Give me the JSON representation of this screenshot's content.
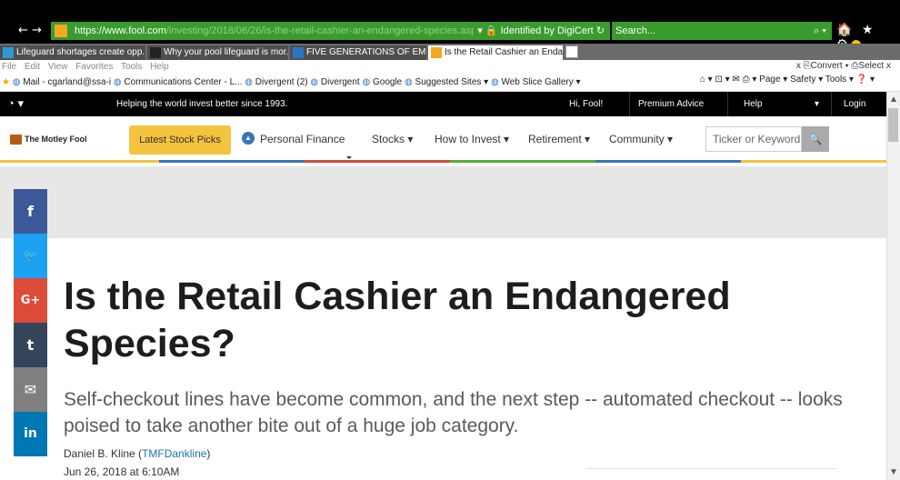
{
  "browser": {
    "nav_icons": "← →",
    "url_host": "https://www.fool.com",
    "url_path": "/investing/2018/06/26/is-the-retail-cashier-an-endangered-species.aspx",
    "security_label": "▾ 🔒 Identified by DigiCert ↻",
    "search_placeholder": "Search...",
    "search_icon": "⌕ ▾",
    "right_icons": "🏠 ★ ⚙"
  },
  "tabs": [
    {
      "label": "Lifeguard shortages create opp...",
      "icon_color": "#2a9bd7"
    },
    {
      "label": "Why your pool lifeguard is mor...",
      "icon_color": "#333333"
    },
    {
      "label": "FIVE GENERATIONS OF EMPLO...",
      "icon_color": "#2a76c6"
    },
    {
      "label": "Is the Retail Cashier an Endan... ×",
      "icon_color": "#f5a623"
    }
  ],
  "menu": {
    "items": [
      "File",
      "Edit",
      "View",
      "Favorites",
      "Tools",
      "Help"
    ],
    "right": "x   ⎘Convert ▾ ⎙Select  x"
  },
  "favorites": {
    "items": [
      "Mail - cgarland@ssa-i",
      "Communications Center - L...",
      "Divergent (2)",
      "Divergent",
      "Google",
      "Suggested Sites ▾",
      "Web Slice Gallery ▾"
    ],
    "right": "⌂ ▾ ⊡ ▾ ✉ ⎙ ▾ Page ▾ Safety ▾ Tools ▾ ❓ ▾"
  },
  "site_bar": {
    "tagline": "Helping the world invest better since 1993.",
    "greeting": "Hi, Fool!",
    "premium": "Premium Advice",
    "help": "Help",
    "login": "Login",
    "menu_glyph": "◔ ▾",
    "down": "▾"
  },
  "site_nav": {
    "logo": "The Motley Fool",
    "latest": "Latest Stock Picks",
    "items": [
      "Personal Finance",
      "Stocks ▾",
      "How to Invest ▾",
      "Retirement ▾",
      "Community ▾"
    ],
    "ticker_placeholder": "Ticker or Keyword",
    "search_glyph": "🔍"
  },
  "social": [
    {
      "name": "facebook",
      "glyph": "f",
      "color": "#3b5998"
    },
    {
      "name": "twitter",
      "glyph": "🐦",
      "color": "#1da1f2"
    },
    {
      "name": "googleplus",
      "glyph": "G+",
      "color": "#dd4b39"
    },
    {
      "name": "tumblr",
      "glyph": "t",
      "color": "#35465c"
    },
    {
      "name": "email",
      "glyph": "✉",
      "color": "#7f7f7f"
    },
    {
      "name": "linkedin",
      "glyph": "in",
      "color": "#0077b5"
    }
  ],
  "article": {
    "headline": "Is the Retail Cashier an Endangered Species?",
    "subhead": "Self-checkout lines have become common, and the next step -- automated checkout -- looks poised to take another bite out of a huge job category.",
    "author": "Daniel B. Kline",
    "author_handle": "TMFDankline",
    "date": "Jun 26, 2018 at 6:10AM"
  },
  "colors": {
    "yellow": "#f4c33d",
    "blue": "#3b73b9",
    "red": "#d64a3a",
    "green": "#5aaa3b"
  }
}
